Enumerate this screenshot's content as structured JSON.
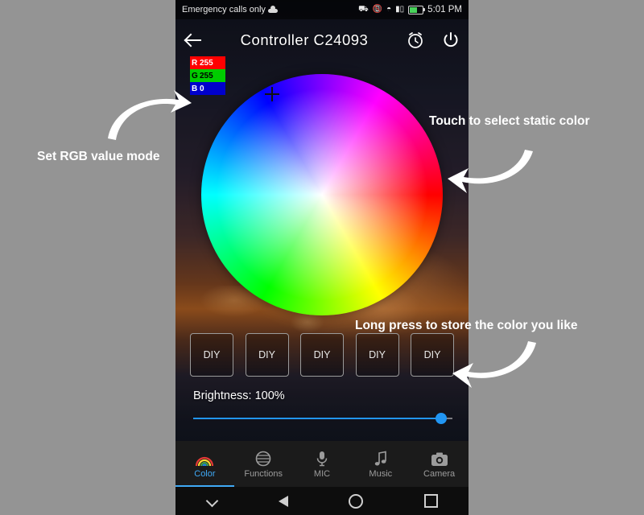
{
  "status_bar": {
    "carrier_text": "Emergency calls only",
    "weather_icon": "cloud-icon",
    "icons": [
      "bluetooth-icon",
      "vibrate-icon",
      "wifi-icon",
      "signal-icon",
      "battery-icon"
    ],
    "clock": "5:01 PM"
  },
  "app_bar": {
    "back_icon": "back-arrow-icon",
    "title": "Controller  C24093",
    "alarm_icon": "alarm-clock-icon",
    "power_icon": "power-icon"
  },
  "rgb": {
    "rows": [
      {
        "channel": "R",
        "value": "255",
        "color": "#ff0000"
      },
      {
        "channel": "G",
        "value": "255",
        "color": "#00cc00"
      },
      {
        "channel": "B",
        "value": "0",
        "color": "#0000cc"
      }
    ]
  },
  "color_wheel": {
    "name": "color-wheel",
    "cursor_icon": "crosshair-icon"
  },
  "diy_buttons": [
    {
      "label": "DIY"
    },
    {
      "label": "DIY"
    },
    {
      "label": "DIY"
    },
    {
      "label": "DIY"
    },
    {
      "label": "DIY"
    }
  ],
  "brightness": {
    "label": "Brightness: 100%",
    "value": 100,
    "accent": "#2196f3"
  },
  "tabs": [
    {
      "label": "Color",
      "icon": "rainbow-icon",
      "active": true
    },
    {
      "label": "Functions",
      "icon": "functions-icon",
      "active": false
    },
    {
      "label": "MIC",
      "icon": "microphone-icon",
      "active": false
    },
    {
      "label": "Music",
      "icon": "music-note-icon",
      "active": false
    },
    {
      "label": "Camera",
      "icon": "camera-icon",
      "active": false
    }
  ],
  "nav_bar": {
    "icons": [
      "chevron-down-icon",
      "back-triangle-icon",
      "home-circle-icon",
      "recents-square-icon"
    ]
  },
  "annotations": {
    "rgb_mode": "Set RGB value mode",
    "touch_static": "Touch to select static color",
    "long_press": "Long press to store the color you like"
  },
  "colors": {
    "page_background": "#949494",
    "accent": "#3fa9f5",
    "annotation_text": "#ffffff"
  }
}
